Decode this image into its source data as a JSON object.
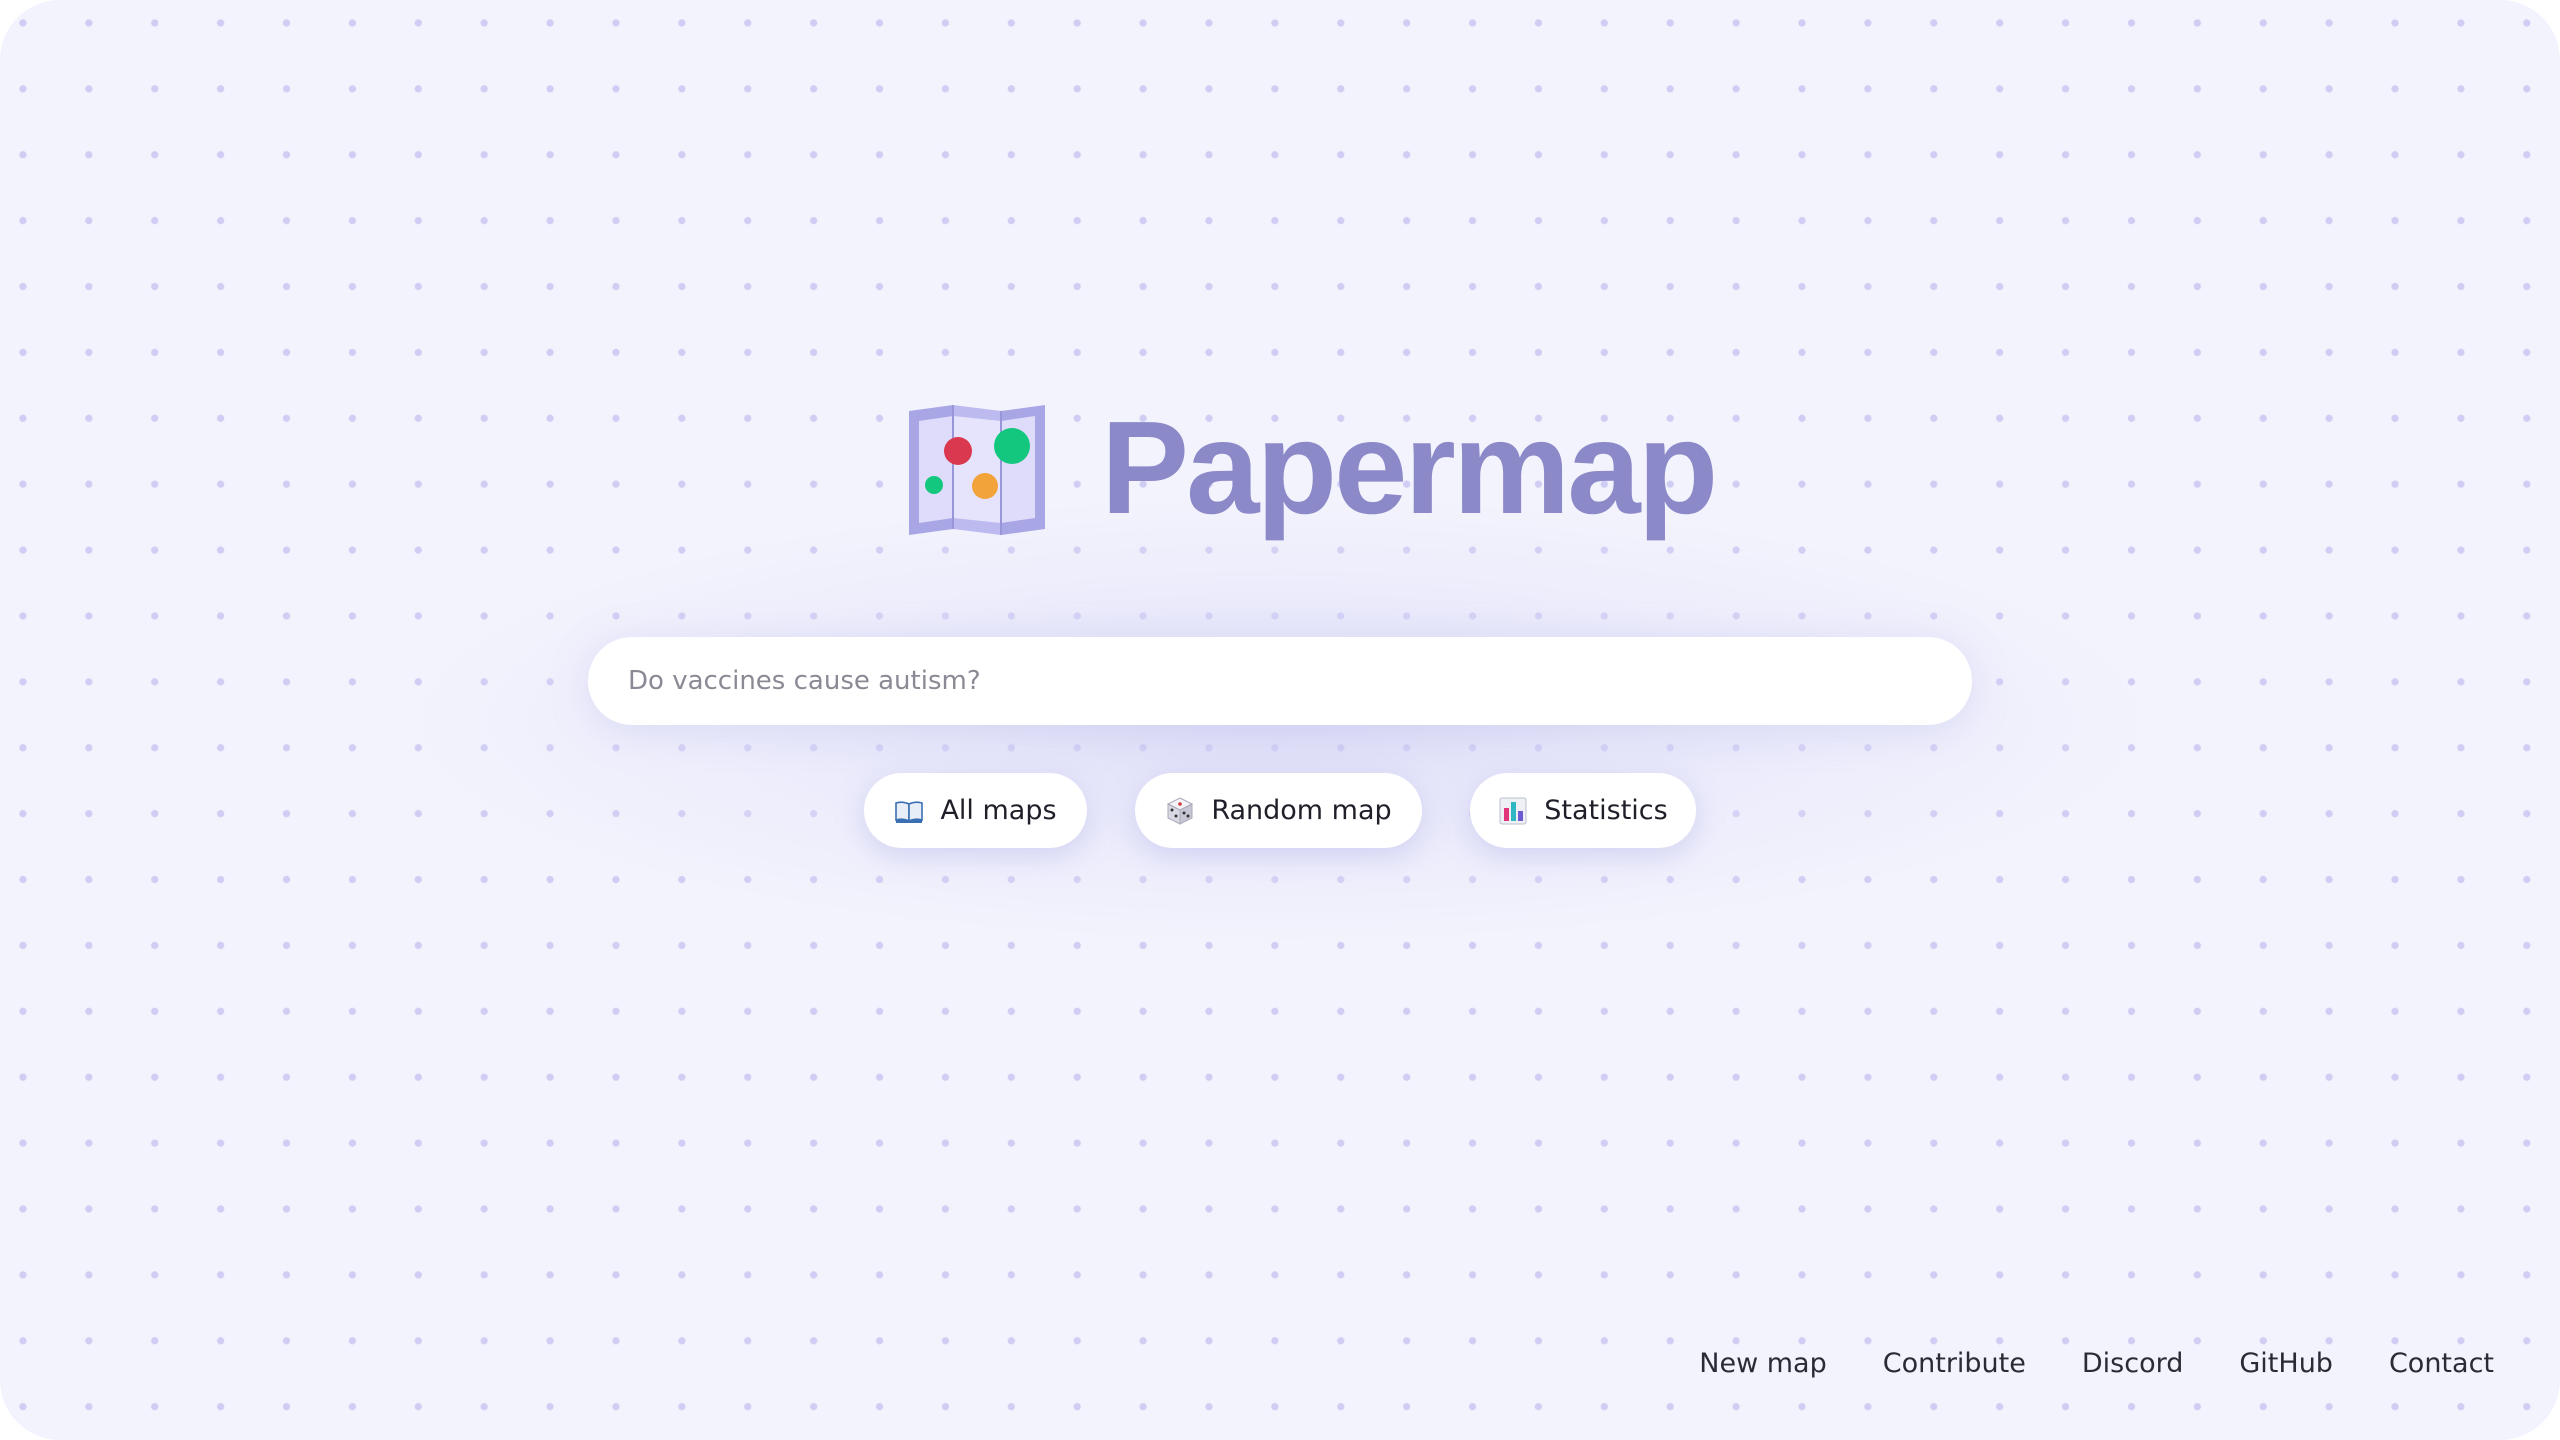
{
  "brand": {
    "name": "Papermap",
    "logo_icon": "folded-map-icon",
    "color": "#8c89c9"
  },
  "search": {
    "placeholder": "Do vaccines cause autism?",
    "value": ""
  },
  "actions": [
    {
      "label": "All maps",
      "icon": "open-book-icon"
    },
    {
      "label": "Random map",
      "icon": "dice-icon"
    },
    {
      "label": "Statistics",
      "icon": "bar-chart-icon"
    }
  ],
  "footer": {
    "links": [
      "New map",
      "Contribute",
      "Discord",
      "GitHub",
      "Contact"
    ]
  },
  "colors": {
    "background": "#f3f3fd",
    "dot": "#cfcdf3",
    "accent": "#8c89c9"
  }
}
